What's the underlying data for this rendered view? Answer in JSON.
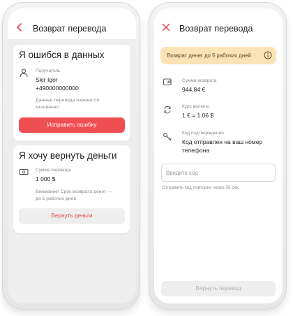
{
  "colors": {
    "accent": "#ef4e52",
    "warning_bg": "#fbe3b8",
    "screen_bg_left": "#eeeeee",
    "disabled_button": "#eeeeee"
  },
  "left_screen": {
    "header": {
      "title": "Возврат перевода",
      "back_icon": "chevron-left-icon"
    },
    "mistake_card": {
      "title": "Я ошибся в данных",
      "recipient_icon": "person-icon",
      "recipient_label": "Получатель",
      "recipient_name": "Skir Igor",
      "recipient_phone": "+490000000000",
      "note_line1": "Данные перевода изменятся",
      "note_line2": "мгновенно",
      "button_label": "Исправить ошибку"
    },
    "refund_card": {
      "title": "Я хочу вернуть деньги",
      "amount_icon": "banknote-icon",
      "amount_label": "Сумма перевода",
      "amount_value": "1 000 $",
      "warning_line1": "Внимание! Срок возврата денег —",
      "warning_line2": "до 5 рабочих дней",
      "button_label": "Вернуть деньги"
    }
  },
  "right_screen": {
    "header": {
      "title": "Возврат перевода",
      "close_icon": "close-icon"
    },
    "banner": {
      "text": "Возврат денег до 5 рабочих дней",
      "icon": "info-icon"
    },
    "refund_amount": {
      "icon": "wallet-icon",
      "label": "Сумма возврата",
      "value": "944.84 €"
    },
    "exchange_rate": {
      "icon": "exchange-icon",
      "label": "Курс валюты",
      "value": "1 € = 1.06 $"
    },
    "confirmation": {
      "icon": "key-icon",
      "label": "Код подтверждения",
      "value_line1": "Код отправлен на ваш номер",
      "value_line2": "телефона"
    },
    "code_input": {
      "placeholder": "Введите код",
      "value": ""
    },
    "resend_text": "Отправить код повторно через 56 сек.",
    "submit_button": "Вернуть перевод"
  }
}
